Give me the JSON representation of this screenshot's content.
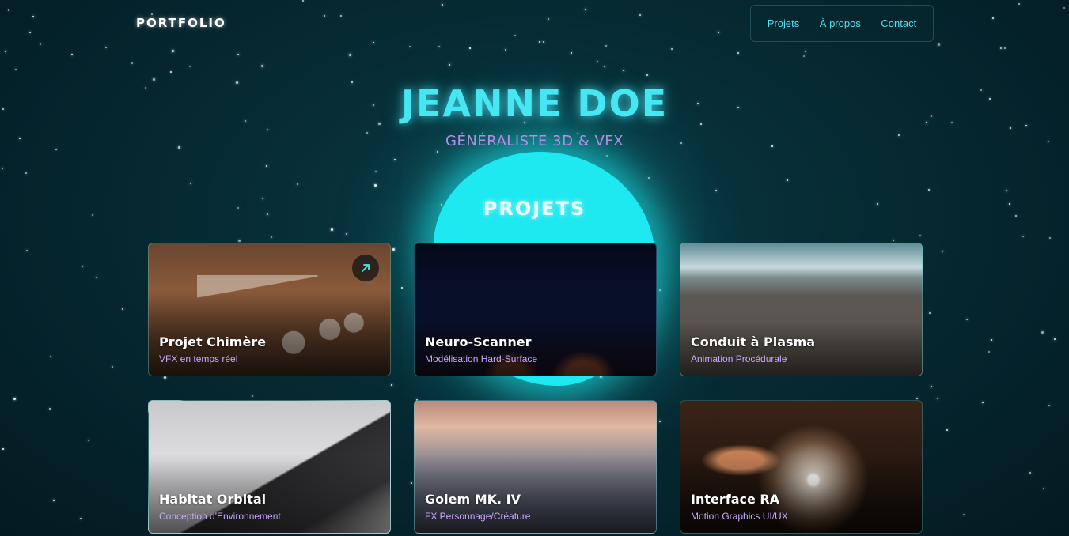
{
  "header": {
    "logo": "PORTFOLIO",
    "nav": [
      {
        "label": "Projets"
      },
      {
        "label": "À propos"
      },
      {
        "label": "Contact"
      }
    ]
  },
  "hero": {
    "name": "JEANNE DOE",
    "role": "GÉNÉRALISTE 3D & VFX"
  },
  "projects_section": {
    "title": "PROJETS",
    "cards": [
      {
        "title": "Projet Chimère",
        "subtitle": "VFX en temps réel",
        "has_link_icon": true
      },
      {
        "title": "Neuro-Scanner",
        "subtitle": "Modélisation Hard-Surface"
      },
      {
        "title": "Conduit à Plasma",
        "subtitle": "Animation Procédurale"
      },
      {
        "title": "Habitat Orbital",
        "subtitle": "Conception d'Environnement"
      },
      {
        "title": "Golem MK. IV",
        "subtitle": "FX Personnage/Créature"
      },
      {
        "title": "Interface RA",
        "subtitle": "Motion Graphics UI/UX"
      }
    ]
  },
  "colors": {
    "accent_cyan": "#46e6f3",
    "accent_purple": "#b48ee6",
    "background": "#062a33",
    "glow": "#1ee9f0"
  }
}
